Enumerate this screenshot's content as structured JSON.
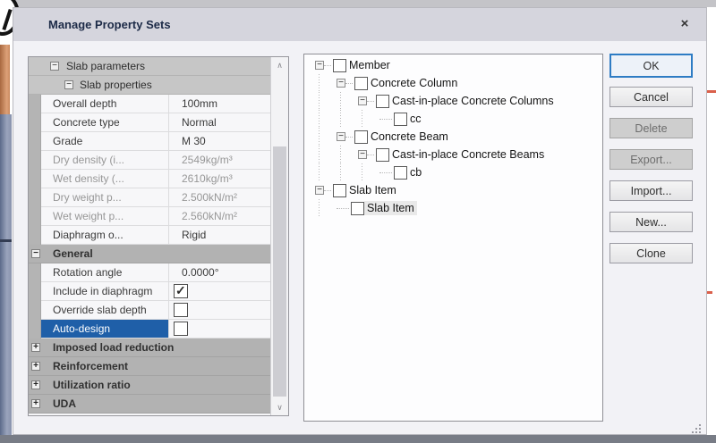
{
  "dialog": {
    "title": "Manage Property Sets",
    "close_glyph": "×"
  },
  "icons": {
    "expander_minus": "−",
    "expander_plus": "+",
    "scroll_up": "∧",
    "scroll_down": "∨"
  },
  "colors": {
    "selection_blue": "#1f5fa8",
    "section_gray": "#b2b2b2",
    "subheader_gray": "#c6c6c6",
    "titlebar": "#d5d5dd",
    "red_marker": "#da604b"
  },
  "property_grid": {
    "rows": [
      {
        "type": "g1",
        "label": "Slab parameters",
        "expander": "minus"
      },
      {
        "type": "g2",
        "label": "Slab properties",
        "expander": "minus"
      },
      {
        "type": "prop",
        "name": "Overall depth",
        "value": "100mm",
        "muted": false
      },
      {
        "type": "prop",
        "name": "Concrete type",
        "value": "Normal",
        "muted": false
      },
      {
        "type": "prop",
        "name": "Grade",
        "value": "M 30",
        "muted": false
      },
      {
        "type": "prop",
        "name": "Dry density (i...",
        "value": "2549kg/m³",
        "muted": true
      },
      {
        "type": "prop",
        "name": "Wet density (...",
        "value": "2610kg/m³",
        "muted": true
      },
      {
        "type": "prop",
        "name": "Dry weight p...",
        "value": "2.500kN/m²",
        "muted": true
      },
      {
        "type": "prop",
        "name": "Wet weight p...",
        "value": "2.560kN/m²",
        "muted": true
      },
      {
        "type": "prop",
        "name": "Diaphragm o...",
        "value": "Rigid",
        "muted": false
      },
      {
        "type": "section",
        "label": "General",
        "expander": "minus"
      },
      {
        "type": "prop",
        "name": "Rotation angle",
        "value": "0.0000°",
        "muted": false
      },
      {
        "type": "check",
        "name": "Include in diaphragm",
        "checked": true,
        "selected": false
      },
      {
        "type": "check",
        "name": "Override slab depth",
        "checked": false,
        "selected": false
      },
      {
        "type": "check",
        "name": "Auto-design",
        "checked": false,
        "selected": true
      },
      {
        "type": "section",
        "label": "Imposed load reduction",
        "expander": "plus"
      },
      {
        "type": "section",
        "label": "Reinforcement",
        "expander": "plus"
      },
      {
        "type": "section",
        "label": "Utilization ratio",
        "expander": "plus"
      },
      {
        "type": "section",
        "label": "UDA",
        "expander": "plus"
      }
    ]
  },
  "tree": {
    "items": [
      {
        "label": "Member",
        "level": 0,
        "expander": "minus",
        "checked": false,
        "selected": false
      },
      {
        "label": "Concrete Column",
        "level": 1,
        "expander": "minus",
        "checked": false,
        "selected": false
      },
      {
        "label": "Cast-in-place Concrete Columns",
        "level": 2,
        "expander": "minus",
        "checked": false,
        "selected": false
      },
      {
        "label": "cc",
        "level": 3,
        "expander": null,
        "checked": false,
        "selected": false
      },
      {
        "label": "Concrete Beam",
        "level": 1,
        "expander": "minus",
        "checked": false,
        "selected": false
      },
      {
        "label": "Cast-in-place Concrete Beams",
        "level": 2,
        "expander": "minus",
        "checked": false,
        "selected": false
      },
      {
        "label": "cb",
        "level": 3,
        "expander": null,
        "checked": false,
        "selected": false
      },
      {
        "label": "Slab Item",
        "level": 0,
        "expander": "minus",
        "checked": false,
        "selected": false
      },
      {
        "label": "Slab Item",
        "level": 1,
        "expander": null,
        "checked": false,
        "selected": true
      }
    ]
  },
  "buttons": [
    {
      "label": "OK",
      "state": "focused"
    },
    {
      "label": "Cancel",
      "state": "normal"
    },
    {
      "label": "Delete",
      "state": "disabled"
    },
    {
      "label": "Export...",
      "state": "disabled"
    },
    {
      "label": "Import...",
      "state": "normal"
    },
    {
      "label": "New...",
      "state": "normal"
    },
    {
      "label": "Clone",
      "state": "normal"
    }
  ]
}
